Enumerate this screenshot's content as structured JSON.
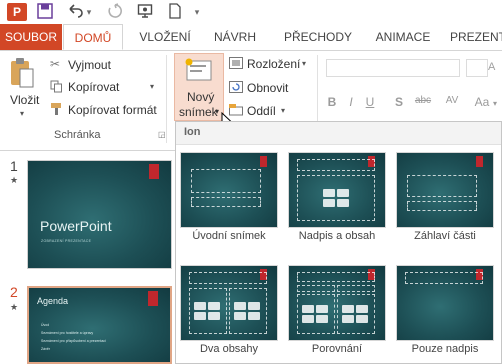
{
  "qat": {
    "logo": "P",
    "save_icon": "save-icon",
    "undo_icon": "undo-icon",
    "redo_icon": "redo-icon",
    "present_icon": "present-icon",
    "new_icon": "new-doc-icon",
    "more_icon": "chevron-down-icon"
  },
  "tabs": {
    "file": "SOUBOR",
    "items": [
      "DOMŮ",
      "VLOŽENÍ",
      "NÁVRH",
      "PŘECHODY",
      "ANIMACE",
      "PREZENT"
    ]
  },
  "clipboard": {
    "paste": "Vložit",
    "cut": "Vyjmout",
    "copy": "Kopírovat",
    "format_painter": "Kopírovat formát",
    "group": "Schránka"
  },
  "slides_group": {
    "new_slide_line1": "Nový",
    "new_slide_line2": "snímek",
    "layout": "Rozložení",
    "reset": "Obnovit",
    "section": "Oddíl"
  },
  "font_group": {
    "bold": "B",
    "italic": "I",
    "underline": "U",
    "shadow": "S",
    "strike": "abc",
    "spacing": "AV",
    "case": "Aa"
  },
  "slides_panel": {
    "slide1": {
      "number": "1",
      "star": "★",
      "title": "PowerPoint",
      "subtitle": "ZOBRAZENÍ PREZENTACE"
    },
    "slide2": {
      "number": "2",
      "star": "★",
      "title": "Agenda",
      "bullets": [
        "Úvod",
        "Seznámení pro hostitele a úpravy",
        "Seznámení pro přizpůsobení a prezentaci",
        "Závěr"
      ]
    }
  },
  "dropdown": {
    "header": "Ion",
    "layouts": [
      "Úvodní snímek",
      "Nadpis a obsah",
      "Záhlaví části",
      "Dva obsahy",
      "Porovnání",
      "Pouze nadpis"
    ]
  },
  "colors": {
    "accent": "#d24726",
    "theme_dark": "#1d4f55",
    "bookmark": "#c0272d"
  }
}
